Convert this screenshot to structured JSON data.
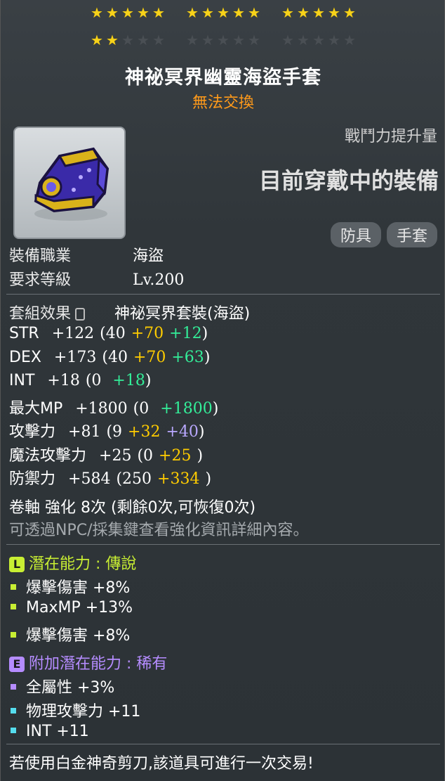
{
  "stars": {
    "row1": [
      5,
      5,
      5
    ],
    "row1_total": [
      5,
      5,
      5
    ],
    "row2": [
      2,
      0,
      0
    ],
    "row2_total": [
      5,
      5,
      5
    ],
    "filled_color": "#f7d21a",
    "empty_color": "#4a4f54"
  },
  "item": {
    "name": "神祕冥界幽靈海盜手套",
    "trade_status": "無法交換",
    "boost_label": "戰鬥力提升量",
    "current_equipped": "目前穿戴中的裝備",
    "tags": [
      "防具",
      "手套"
    ],
    "icon": "purple-gold-glove-icon"
  },
  "requirements": {
    "job_label": "裝備職業",
    "job_value": "海盜",
    "level_label": "要求等級",
    "level_value": "Lv.200"
  },
  "set": {
    "label": "套組效果",
    "value": "神祕冥界套裝(海盜)"
  },
  "stats": [
    {
      "name": "STR",
      "total": "+122",
      "open": "(40",
      "a": "+70",
      "b": "+12",
      "close": ")"
    },
    {
      "name": "DEX",
      "total": "+173",
      "open": "(40",
      "a": "+70",
      "b": "+63",
      "close": ")"
    },
    {
      "name": "INT",
      "total": "+18",
      "open": "(0",
      "a": "",
      "b": "+18",
      "close": ")"
    },
    {
      "name": "最大MP",
      "total": "+1800",
      "open": "(0",
      "a": "",
      "b": "+1800",
      "close": ")"
    },
    {
      "name": "攻擊力",
      "total": "+81",
      "open": "(9",
      "a": "+32",
      "b": "+40",
      "close": ")"
    },
    {
      "name": "魔法攻擊力",
      "total": "+25",
      "open": "(0",
      "a": "+25",
      "b": "",
      "close": ")"
    },
    {
      "name": "防禦力",
      "total": "+584",
      "open": "(250",
      "a": "+334",
      "b": "",
      "close": ")"
    }
  ],
  "upgrade": {
    "line": "卷軸 強化 8次 (剩餘0次,可恢復0次)",
    "hint": "可透過NPC/採集鍵查看強化資訊詳細內容。"
  },
  "potential": {
    "badge": "L",
    "title": "潛在能力 : 傳說",
    "color": "#c8ee33",
    "lines": [
      "爆擊傷害 +8%",
      "MaxMP +13%",
      "爆擊傷害 +8%"
    ]
  },
  "bonus_potential": {
    "badge": "E",
    "title": "附加潛在能力 : 稀有",
    "color": "#b58cff",
    "lines": [
      "全屬性 +3%",
      "物理攻擊力 +11",
      "INT +11"
    ],
    "bullet_colors": [
      "#b58cff",
      "#55ddee",
      "#55ddee"
    ]
  },
  "footer": "若使用白金神奇剪刀,該道具可進行一次交易!"
}
